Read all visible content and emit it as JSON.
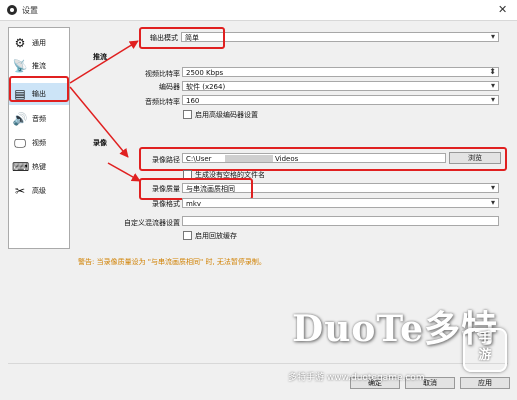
{
  "window": {
    "title": "设置",
    "close_glyph": "✕"
  },
  "sidebar": {
    "items": [
      {
        "label": "通用",
        "icon": "gear-icon",
        "glyph": "⚙"
      },
      {
        "label": "推流",
        "icon": "broadcast-icon",
        "glyph": "📡"
      },
      {
        "label": "输出",
        "icon": "output-icon",
        "glyph": "▤"
      },
      {
        "label": "音频",
        "icon": "speaker-icon",
        "glyph": "🔊"
      },
      {
        "label": "视频",
        "icon": "monitor-icon",
        "glyph": "🖵"
      },
      {
        "label": "热键",
        "icon": "keyboard-icon",
        "glyph": "⌨"
      },
      {
        "label": "高级",
        "icon": "tools-icon",
        "glyph": "✂"
      }
    ],
    "active_index": 2
  },
  "output": {
    "mode_label": "输出模式",
    "mode_value": "简单",
    "streaming": {
      "section": "推流",
      "video_bitrate_label": "视频比特率",
      "video_bitrate_value": "2500 Kbps",
      "encoder_label": "编码器",
      "encoder_value": "软件 (x264)",
      "audio_bitrate_label": "音频比特率",
      "audio_bitrate_value": "160",
      "advanced_encoder_check": "启用高级编码器设置"
    },
    "recording": {
      "section": "录像",
      "path_label": "录像路径",
      "path_prefix": "C:\\User",
      "path_suffix": "Videos",
      "browse_button": "浏览",
      "no_space_check": "生成没有空格的文件名",
      "quality_label": "录像质量",
      "quality_value": "与串流画质相同",
      "format_label": "录像格式",
      "format_value": "mkv",
      "custom_muxer_label": "自定义混流器设置",
      "replay_buffer_check": "启用回放缓存"
    },
    "warning": "警告: 当录像质量设为 \"与串流画质相同\" 时, 无法暂停录制。"
  },
  "footer": {
    "ok": "确定",
    "cancel": "取消",
    "apply": "应用"
  },
  "watermark": {
    "brand": "DuoTe多特",
    "site": "多特手游 www.duotegame.com",
    "badge_line1": "手",
    "badge_line2": "游"
  },
  "colors": {
    "highlight": "#e02020",
    "warning": "#d08000",
    "active_item": "#cce4f7"
  }
}
